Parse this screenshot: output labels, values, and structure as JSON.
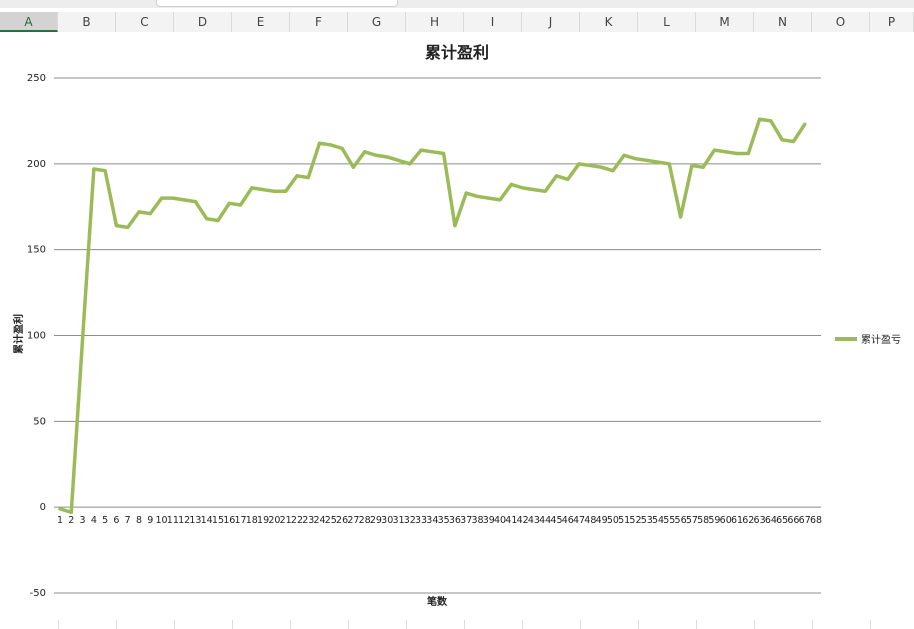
{
  "spreadsheet": {
    "columns": [
      "A",
      "B",
      "C",
      "D",
      "E",
      "F",
      "G",
      "H",
      "I",
      "J",
      "K",
      "L",
      "M",
      "N",
      "O",
      "P"
    ],
    "active_column": "A"
  },
  "chart_data": {
    "type": "line",
    "title": "累计盈利",
    "xlabel": "笔数",
    "ylabel": "累计盈利",
    "ylim": [
      -50,
      250
    ],
    "yticks": [
      -50,
      0,
      50,
      100,
      150,
      200,
      250
    ],
    "grid": true,
    "legend_position": "right",
    "categories": [
      "1",
      "2",
      "3",
      "4",
      "5",
      "6",
      "7",
      "8",
      "9",
      "10",
      "11",
      "12",
      "13",
      "14",
      "15",
      "16",
      "17",
      "18",
      "19",
      "20",
      "21",
      "22",
      "23",
      "24",
      "25",
      "26",
      "27",
      "28",
      "29",
      "30",
      "31",
      "32",
      "33",
      "34",
      "35",
      "36",
      "37",
      "38",
      "39",
      "40",
      "41",
      "42",
      "43",
      "44",
      "45",
      "46",
      "47",
      "48",
      "49",
      "50",
      "51",
      "52",
      "53",
      "54",
      "55",
      "56",
      "57",
      "58",
      "59",
      "60",
      "61",
      "62",
      "63",
      "64",
      "65",
      "66",
      "67",
      "68"
    ],
    "series": [
      {
        "name": "累计盈亏",
        "color": "#9bbb59",
        "values": [
          -1,
          -3,
          98,
          197,
          196,
          164,
          163,
          172,
          171,
          180,
          180,
          179,
          178,
          168,
          167,
          177,
          176,
          186,
          185,
          184,
          184,
          193,
          192,
          212,
          211,
          209,
          198,
          207,
          205,
          204,
          202,
          200,
          208,
          207,
          206,
          164,
          183,
          181,
          180,
          179,
          188,
          186,
          185,
          184,
          193,
          191,
          200,
          199,
          198,
          196,
          205,
          203,
          202,
          201,
          200,
          169,
          199,
          198,
          208,
          207,
          206,
          206,
          226,
          225,
          214,
          213,
          223
        ]
      }
    ]
  }
}
